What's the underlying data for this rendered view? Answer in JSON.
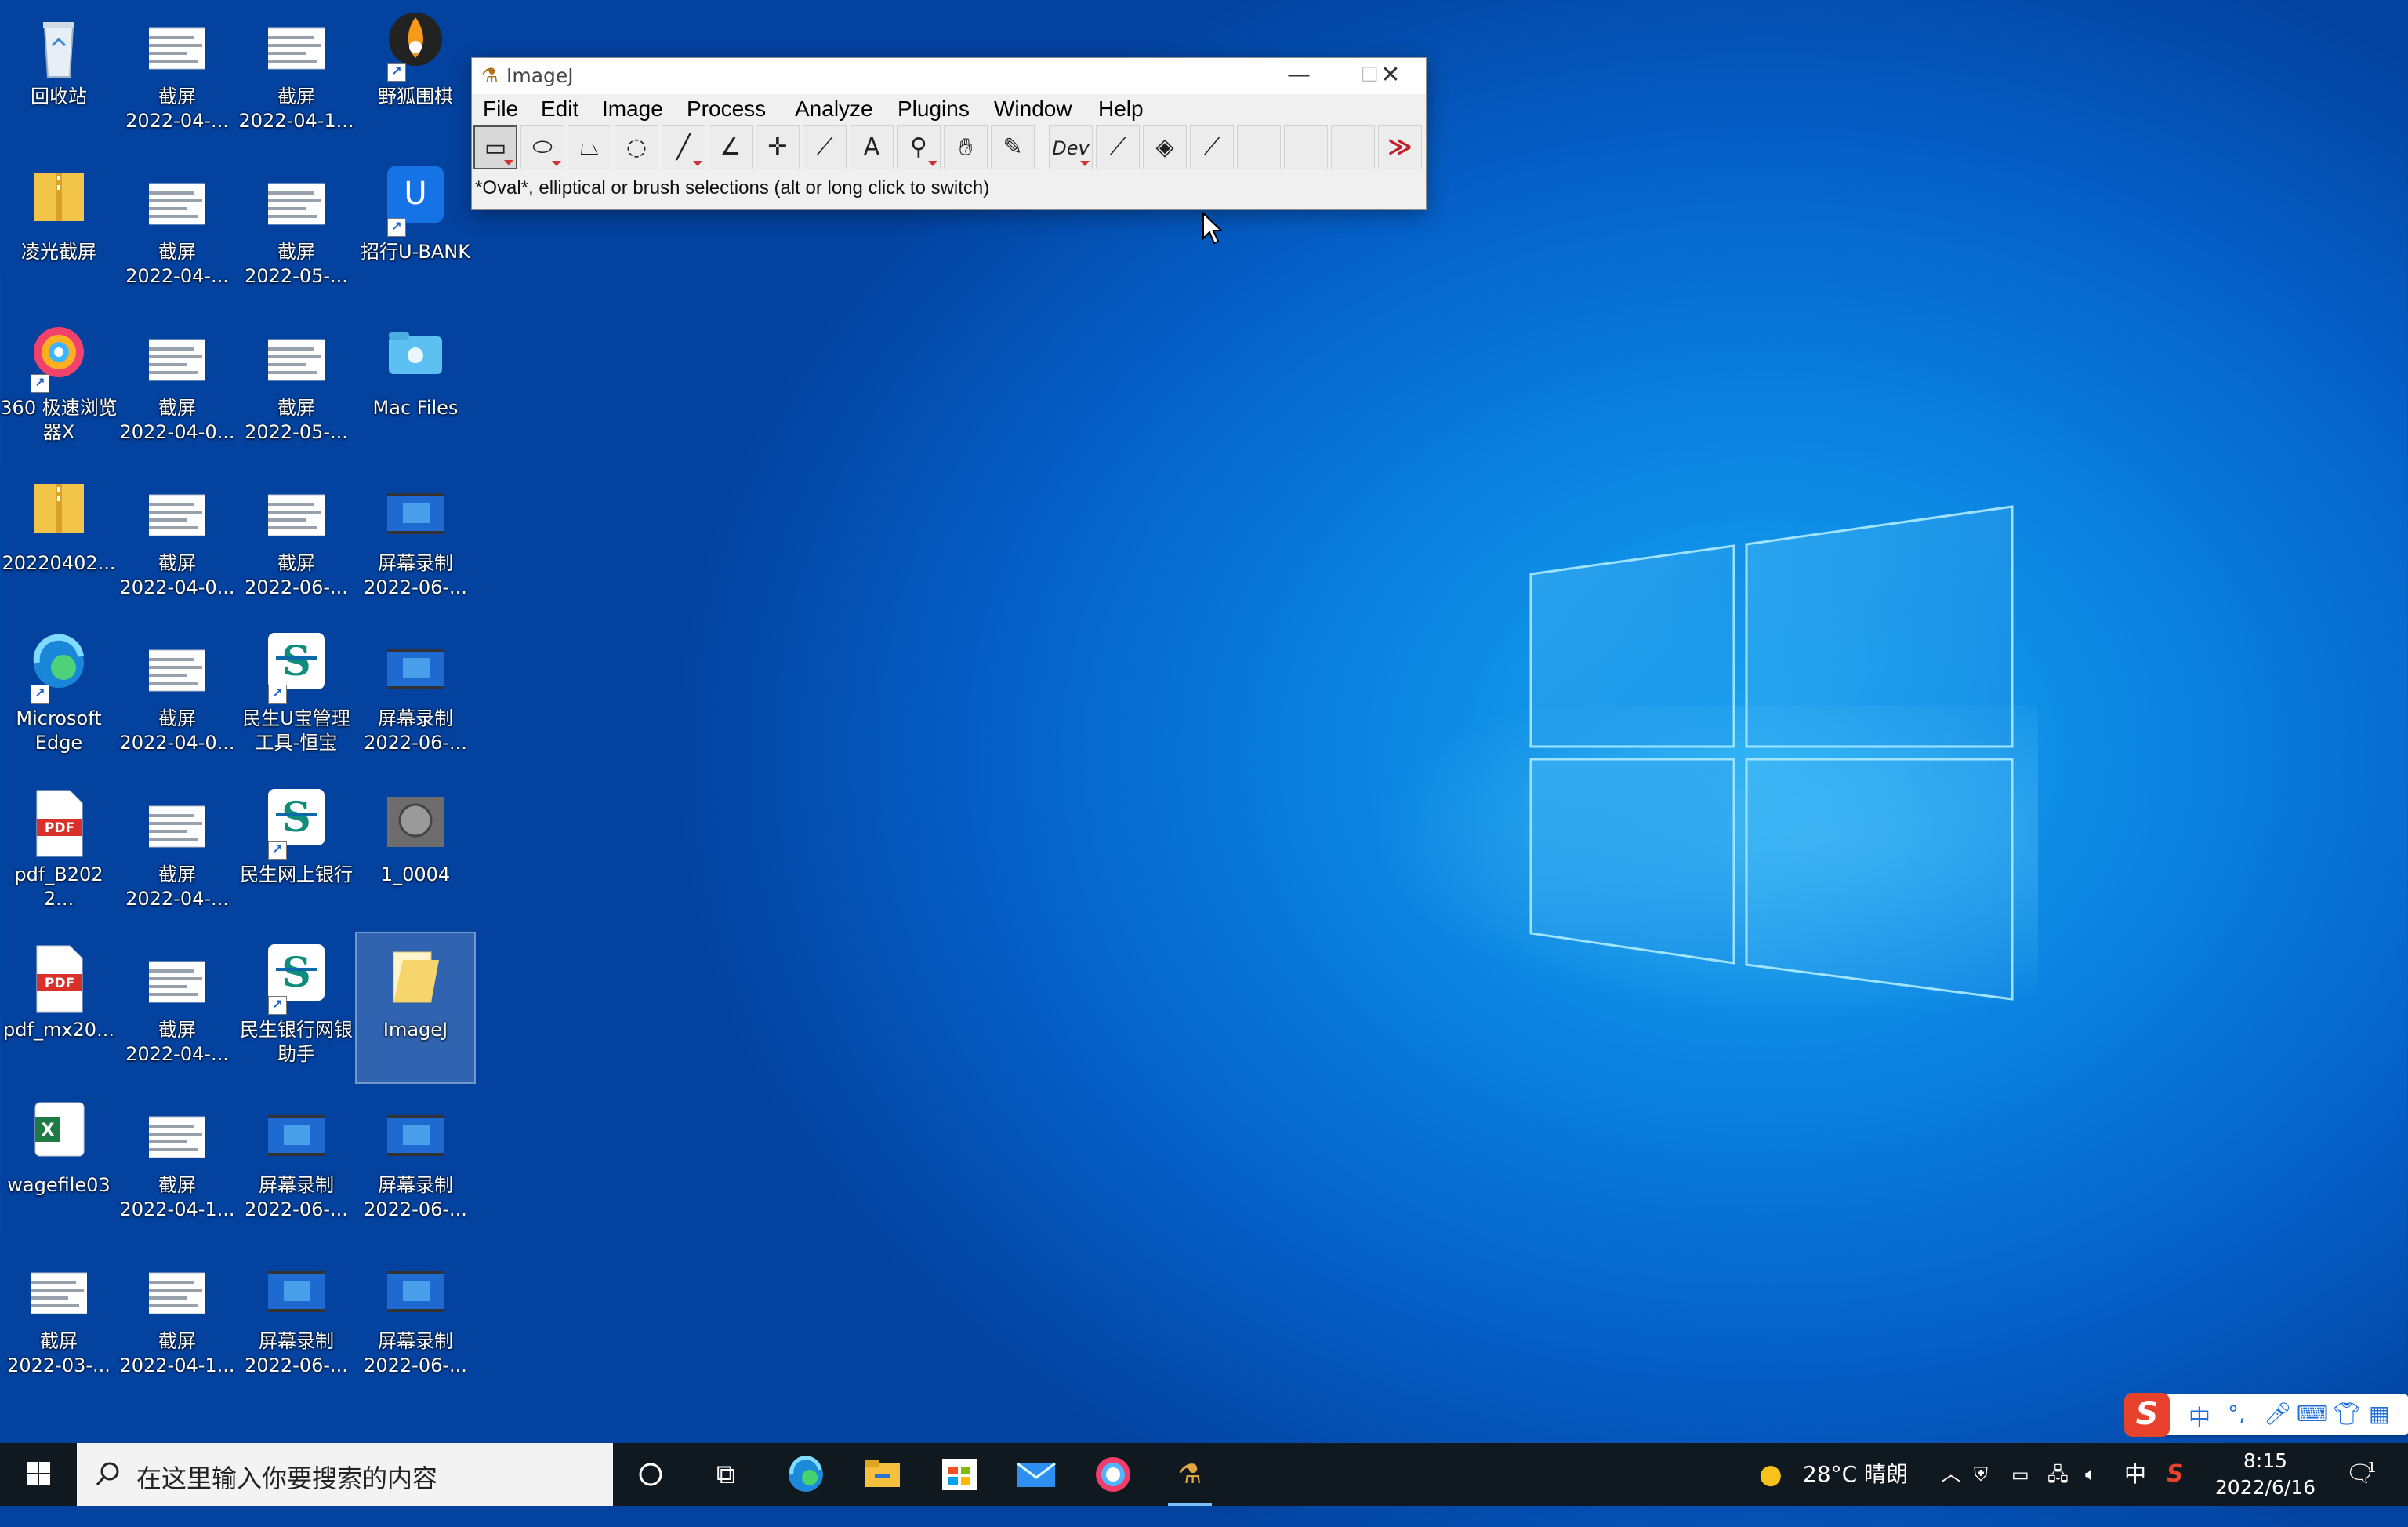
{
  "desktop": {
    "icons": [
      {
        "label": "回收站"
      },
      {
        "label": "截屏\n2022-04-..."
      },
      {
        "label": "截屏\n2022-04-1..."
      },
      {
        "label": "野狐围棋"
      },
      {
        "label": "凌光截屏"
      },
      {
        "label": "截屏\n2022-04-..."
      },
      {
        "label": "截屏\n2022-05-..."
      },
      {
        "label": "招行U-BANK"
      },
      {
        "label": "360 极速浏览\n器X"
      },
      {
        "label": "截屏\n2022-04-0..."
      },
      {
        "label": "截屏\n2022-05-..."
      },
      {
        "label": "Mac Files"
      },
      {
        "label": "20220402..."
      },
      {
        "label": "截屏\n2022-04-0..."
      },
      {
        "label": "截屏\n2022-06-..."
      },
      {
        "label": "屏幕录制\n2022-06-..."
      },
      {
        "label": "Microsoft\nEdge"
      },
      {
        "label": "截屏\n2022-04-0..."
      },
      {
        "label": "民生U宝管理\n工具-恒宝"
      },
      {
        "label": "屏幕录制\n2022-06-..."
      },
      {
        "label": "pdf_B2022..."
      },
      {
        "label": "截屏\n2022-04-..."
      },
      {
        "label": "民生网上银行"
      },
      {
        "label": "1_0004"
      },
      {
        "label": "pdf_mx20..."
      },
      {
        "label": "截屏\n2022-04-..."
      },
      {
        "label": "民生银行网银\n助手"
      },
      {
        "label": "ImageJ"
      },
      {
        "label": "wagefile03"
      },
      {
        "label": "截屏\n2022-04-1..."
      },
      {
        "label": "屏幕录制\n2022-06-..."
      },
      {
        "label": "屏幕录制\n2022-06-..."
      },
      {
        "label": "截屏\n2022-03-..."
      },
      {
        "label": "截屏\n2022-04-1..."
      },
      {
        "label": "屏幕录制\n2022-06-..."
      },
      {
        "label": "屏幕录制\n2022-06-..."
      }
    ]
  },
  "imagej": {
    "title": "ImageJ",
    "menus": [
      "File",
      "Edit",
      "Image",
      "Process",
      "Analyze",
      "Plugins",
      "Window",
      "Help"
    ],
    "tools": [
      {
        "icon": "rectangle-tool-icon"
      },
      {
        "icon": "oval-tool-icon"
      },
      {
        "icon": "polygon-tool-icon"
      },
      {
        "icon": "freehand-tool-icon"
      },
      {
        "icon": "line-tool-icon"
      },
      {
        "icon": "angle-tool-icon"
      },
      {
        "icon": "point-tool-icon"
      },
      {
        "icon": "wand-tool-icon"
      },
      {
        "icon": "text-tool-icon"
      },
      {
        "icon": "zoom-tool-icon"
      },
      {
        "icon": "hand-tool-icon"
      },
      {
        "icon": "color-picker-icon"
      },
      {
        "icon": "developer-menu-icon",
        "label": "Dev"
      },
      {
        "icon": "brush-tool-icon"
      },
      {
        "icon": "flood-fill-icon"
      },
      {
        "icon": "pencil-tool-icon"
      },
      {
        "icon": "empty-slot-icon"
      },
      {
        "icon": "empty-slot-icon"
      },
      {
        "icon": "empty-slot-icon"
      },
      {
        "icon": "more-tools-icon"
      }
    ],
    "status": "*Oval*, elliptical or brush selections (alt or long click to switch)"
  },
  "ime": {
    "mode": "中",
    "punct": "°,"
  },
  "taskbar": {
    "search_placeholder": "在这里输入你要搜索的内容",
    "weather": "28°C  晴朗",
    "ime_lang": "中",
    "time": "8:15",
    "date": "2022/6/16",
    "notifications": "1"
  },
  "colors": {
    "accent": "#0a7ae0",
    "taskbar": "#101820",
    "imagej_arrow": "#c0202a"
  }
}
